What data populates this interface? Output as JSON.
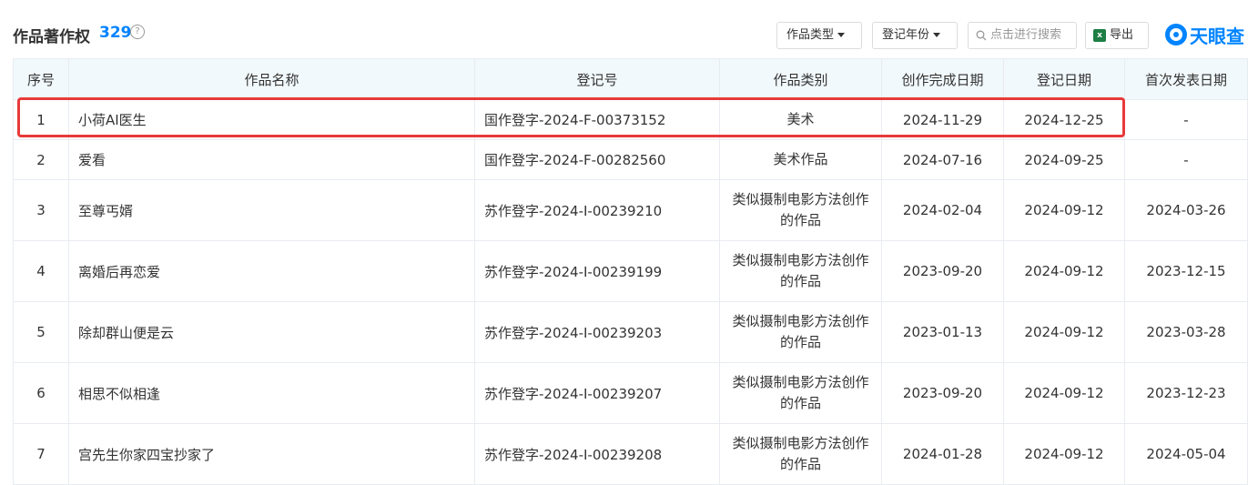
{
  "header": {
    "title": "作品著作权",
    "count": "329",
    "help": "?",
    "filter_type": "作品类型",
    "filter_year": "登记年份",
    "search_placeholder": "点击进行搜索",
    "export": "导出",
    "excel_glyph": "x",
    "logo": "天眼查"
  },
  "table": {
    "columns": [
      "序号",
      "作品名称",
      "登记号",
      "作品类别",
      "创作完成日期",
      "登记日期",
      "首次发表日期"
    ],
    "rows": [
      {
        "no": "1",
        "name": "小荷AI医生",
        "reg": "国作登字-2024-F-00373152",
        "cat1": "美术",
        "cat2": "",
        "created": "2024-11-29",
        "registered": "2024-12-25",
        "published": "-"
      },
      {
        "no": "2",
        "name": "爱看",
        "reg": "国作登字-2024-F-00282560",
        "cat1": "美术作品",
        "cat2": "",
        "created": "2024-07-16",
        "registered": "2024-09-25",
        "published": "-"
      },
      {
        "no": "3",
        "name": "至尊丐婿",
        "reg": "苏作登字-2024-I-00239210",
        "cat1": "类似摄制电影方法创作",
        "cat2": "的作品",
        "created": "2024-02-04",
        "registered": "2024-09-12",
        "published": "2024-03-26"
      },
      {
        "no": "4",
        "name": "离婚后再恋爱",
        "reg": "苏作登字-2024-I-00239199",
        "cat1": "类似摄制电影方法创作",
        "cat2": "的作品",
        "created": "2023-09-20",
        "registered": "2024-09-12",
        "published": "2023-12-15"
      },
      {
        "no": "5",
        "name": "除却群山便是云",
        "reg": "苏作登字-2024-I-00239203",
        "cat1": "类似摄制电影方法创作",
        "cat2": "的作品",
        "created": "2023-01-13",
        "registered": "2024-09-12",
        "published": "2023-03-28"
      },
      {
        "no": "6",
        "name": "相思不似相逢",
        "reg": "苏作登字-2024-I-00239207",
        "cat1": "类似摄制电影方法创作",
        "cat2": "的作品",
        "created": "2023-09-20",
        "registered": "2024-09-12",
        "published": "2023-12-23"
      },
      {
        "no": "7",
        "name": "宫先生你家四宝抄家了",
        "reg": "苏作登字-2024-I-00239208",
        "cat1": "类似摄制电影方法创作",
        "cat2": "的作品",
        "created": "2024-01-28",
        "registered": "2024-09-12",
        "published": "2024-05-04"
      }
    ]
  },
  "colors": {
    "accent": "#0084ff",
    "highlight": "#e83a3a",
    "header_bg": "#f2f9fc"
  }
}
